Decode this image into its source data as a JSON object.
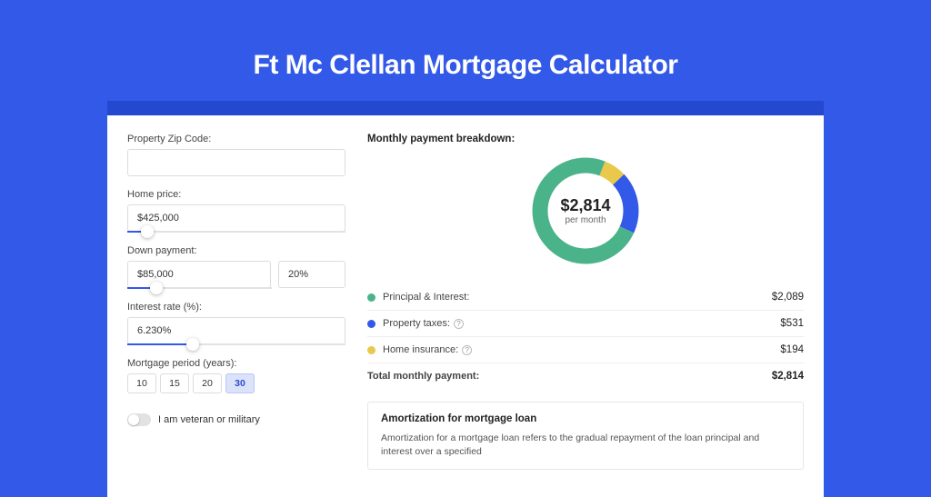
{
  "page": {
    "title": "Ft Mc Clellan Mortgage Calculator"
  },
  "form": {
    "zip_label": "Property Zip Code:",
    "zip_value": "",
    "home_price_label": "Home price:",
    "home_price_value": "$425,000",
    "home_price_slider_pct": 9,
    "down_payment_label": "Down payment:",
    "down_payment_value": "$85,000",
    "down_payment_pct_value": "20%",
    "down_payment_slider_pct": 20,
    "interest_label": "Interest rate (%):",
    "interest_value": "6.230%",
    "interest_slider_pct": 30,
    "period_label": "Mortgage period (years):",
    "periods": [
      "10",
      "15",
      "20",
      "30"
    ],
    "period_selected_index": 3,
    "veteran_label": "I am veteran or military"
  },
  "breakdown": {
    "title": "Monthly payment breakdown:",
    "center_amount": "$2,814",
    "center_sub": "per month",
    "items": [
      {
        "label": "Principal & Interest:",
        "value": "$2,089",
        "color": "c-green",
        "info": false,
        "pct": 74.2
      },
      {
        "label": "Property taxes:",
        "value": "$531",
        "color": "c-blue",
        "info": true,
        "pct": 18.9
      },
      {
        "label": "Home insurance:",
        "value": "$194",
        "color": "c-yellow",
        "info": true,
        "pct": 6.9
      }
    ],
    "total_label": "Total monthly payment:",
    "total_value": "$2,814"
  },
  "amortization": {
    "title": "Amortization for mortgage loan",
    "text": "Amortization for a mortgage loan refers to the gradual repayment of the loan principal and interest over a specified"
  },
  "chart_data": {
    "type": "pie",
    "title": "Monthly payment breakdown",
    "series": [
      {
        "name": "Principal & Interest",
        "value": 2089
      },
      {
        "name": "Property taxes",
        "value": 531
      },
      {
        "name": "Home insurance",
        "value": 194
      }
    ],
    "total": 2814
  }
}
